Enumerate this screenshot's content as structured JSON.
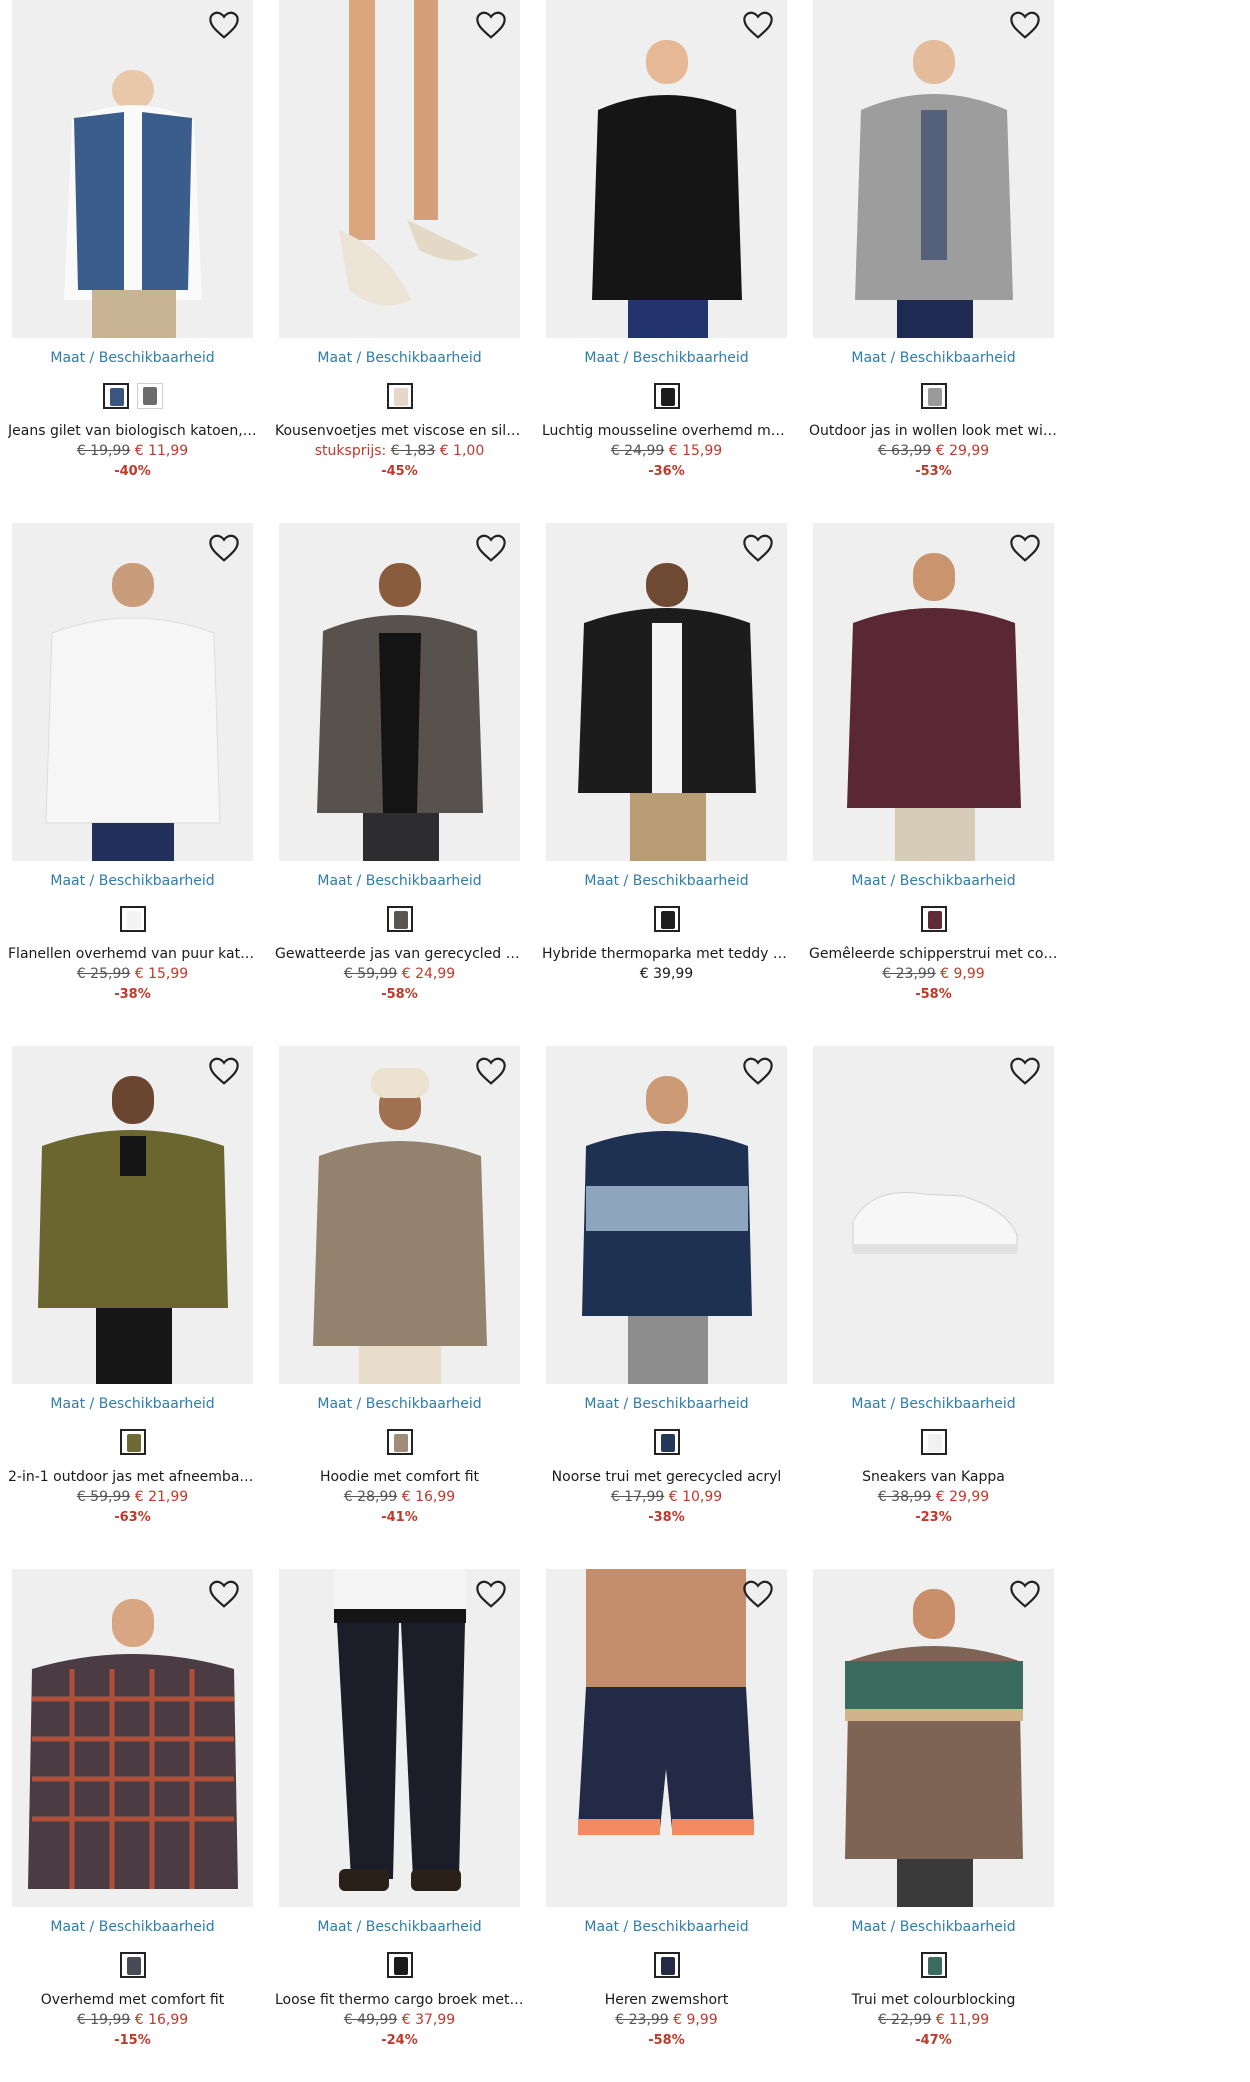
{
  "size_link_label": "Maat / Beschikbaarheid",
  "colors": {
    "link": "#2f7da8",
    "sale_price": "#c0392b",
    "discount": "#c0392b"
  },
  "products": [
    {
      "name": "Jeans gilet van biologisch katoen, r…",
      "old_price": "€ 19,99",
      "price": "€ 11,99",
      "price_label": "",
      "discount": "-40%",
      "swatches": [
        "#3a5580",
        "#6b6b6b"
      ],
      "image": "denim-vest"
    },
    {
      "name": "Kousenvoetjes met viscose en silico…",
      "old_price": "€ 1,83",
      "price": "€ 1,00",
      "price_label": "stuksprijs:",
      "discount": "-45%",
      "swatches": [
        "#e5d8c8"
      ],
      "image": "socks"
    },
    {
      "name": "Luchtig mousseline overhemd met l…",
      "old_price": "€ 24,99",
      "price": "€ 15,99",
      "price_label": "",
      "discount": "-36%",
      "swatches": [
        "#1c1c1c"
      ],
      "image": "black-shirt"
    },
    {
      "name": "Outdoor jas in wollen look met win…",
      "old_price": "€ 63,99",
      "price": "€ 29,99",
      "price_label": "",
      "discount": "-53%",
      "swatches": [
        "#9a9a9a"
      ],
      "image": "grey-coat"
    },
    {
      "name": "Flanellen overhemd van puur katoe…",
      "old_price": "€ 25,99",
      "price": "€ 15,99",
      "price_label": "",
      "discount": "-38%",
      "swatches": [
        "#f4f4f4"
      ],
      "image": "white-shirt"
    },
    {
      "name": "Gewatteerde jas van gerecycled po…",
      "old_price": "€ 59,99",
      "price": "€ 24,99",
      "price_label": "",
      "discount": "-58%",
      "swatches": [
        "#5a5550"
      ],
      "image": "puffer"
    },
    {
      "name": "Hybride thermoparka met teddy vo…",
      "old_price": "",
      "price": "€ 39,99",
      "price_label": "",
      "discount": "",
      "swatches": [
        "#1d1d1d"
      ],
      "image": "parka"
    },
    {
      "name": "Gemêleerde schipperstrui met com…",
      "old_price": "€ 23,99",
      "price": "€ 9,99",
      "price_label": "",
      "discount": "-58%",
      "swatches": [
        "#5e2a36"
      ],
      "image": "burgundy"
    },
    {
      "name": "2-in-1 outdoor jas met afneembare …",
      "old_price": "€ 59,99",
      "price": "€ 21,99",
      "price_label": "",
      "discount": "-63%",
      "swatches": [
        "#6d6a33"
      ],
      "image": "olive-jacket"
    },
    {
      "name": "Hoodie met comfort fit",
      "old_price": "€ 28,99",
      "price": "€ 16,99",
      "price_label": "",
      "discount": "-41%",
      "swatches": [
        "#a08c78"
      ],
      "image": "hoodie"
    },
    {
      "name": "Noorse trui met gerecycled acryl",
      "old_price": "€ 17,99",
      "price": "€ 10,99",
      "price_label": "",
      "discount": "-38%",
      "swatches": [
        "#24385a"
      ],
      "image": "nordic"
    },
    {
      "name": "Sneakers van Kappa",
      "old_price": "€ 38,99",
      "price": "€ 29,99",
      "price_label": "",
      "discount": "-23%",
      "swatches": [
        "#f1f1f1"
      ],
      "image": "sneaker"
    },
    {
      "name": "Overhemd met comfort fit",
      "old_price": "€ 19,99",
      "price": "€ 16,99",
      "price_label": "",
      "discount": "-15%",
      "swatches": [
        "#4a4a55"
      ],
      "image": "plaid"
    },
    {
      "name": "Loose fit thermo cargo broek met t…",
      "old_price": "€ 49,99",
      "price": "€ 37,99",
      "price_label": "",
      "discount": "-24%",
      "swatches": [
        "#1b1b1b"
      ],
      "image": "cargo"
    },
    {
      "name": "Heren zwemshort",
      "old_price": "€ 23,99",
      "price": "€ 9,99",
      "price_label": "",
      "discount": "-58%",
      "swatches": [
        "#232a45"
      ],
      "image": "swim"
    },
    {
      "name": "Trui met colourblocking",
      "old_price": "€ 22,99",
      "price": "€ 11,99",
      "price_label": "",
      "discount": "-47%",
      "swatches": [
        "#3d6b5e"
      ],
      "image": "colourblock"
    }
  ]
}
